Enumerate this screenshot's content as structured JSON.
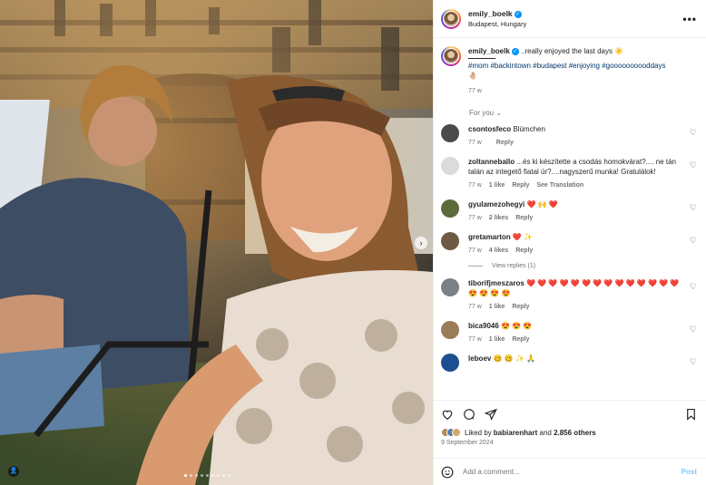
{
  "post": {
    "username": "emily_boelk",
    "location": "Budapest, Hungary",
    "more_label": "•••"
  },
  "caption": {
    "username": "emily_boelk",
    "text": " ..really enjoyed the last days ☀️",
    "tags": "#mom #backintown #budapest #enjoying #goooooooooddays",
    "emoji": "🤚🏼",
    "time": "77 w"
  },
  "for_you_label": "For you ⌄",
  "comments": [
    {
      "user": "csontosfeco",
      "text": "Blümchen",
      "time": "77 w",
      "likes": "",
      "reply": "Reply",
      "translate": "",
      "avatar_color": "#4a4a4a"
    },
    {
      "user": "zoltanneballo",
      "text": "...és ki készítette a csodás homokvárat?.... ne tán talán az integető fiatal úr?....nagyszerű munka! Gratulálok!",
      "time": "77 w",
      "likes": "1 like",
      "reply": "Reply",
      "translate": "See Translation",
      "avatar_color": "#dbdbdb"
    },
    {
      "user": "gyulamezohegyi",
      "text": "❤️ 🙌 ❤️",
      "time": "77 w",
      "likes": "2 likes",
      "reply": "Reply",
      "translate": "",
      "avatar_color": "#5b6b3a"
    },
    {
      "user": "gretamarton",
      "text": "❤️ ✨",
      "time": "77 w",
      "likes": "4 likes",
      "reply": "Reply",
      "translate": "",
      "avatar_color": "#6e5a44"
    },
    {
      "user": "tiborifjmeszaros",
      "text": "❤️ ❤️ ❤️ ❤️ ❤️ ❤️ ❤️ ❤️ ❤️ ❤️ ❤️ ❤️ ❤️ ❤️ 😍 😍 😍 😍",
      "time": "77 w",
      "likes": "1 like",
      "reply": "Reply",
      "translate": "",
      "avatar_color": "#7b7f86"
    },
    {
      "user": "bica9046",
      "text": "😍 😍 😍",
      "time": "77 w",
      "likes": "1 like",
      "reply": "Reply",
      "translate": "",
      "avatar_color": "#9a7c5a"
    },
    {
      "user": "leboev",
      "text": "🥴 🥴 ✨ 🙏",
      "time": "",
      "likes": "",
      "reply": "",
      "translate": "",
      "avatar_color": "#1d4e8f"
    }
  ],
  "view_replies": "View replies (1)",
  "likes": {
    "prefix": "Liked by ",
    "user": "babiarenhart",
    "middle": " and ",
    "count": "2.856 others"
  },
  "date": "9 September 2024",
  "add_comment_placeholder": "Add a comment...",
  "post_button": "Post",
  "colors": {
    "link": "#00376b",
    "muted": "#737373",
    "accent": "#0095f6"
  }
}
